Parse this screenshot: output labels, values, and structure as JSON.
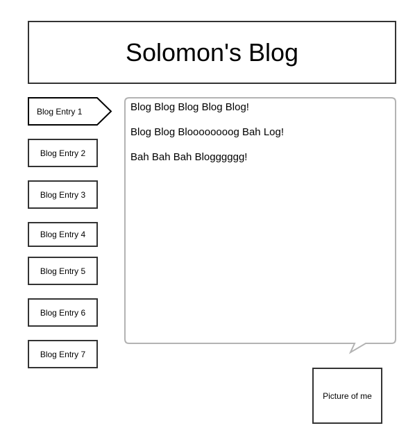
{
  "header": {
    "title": "Solomon's Blog"
  },
  "sidebar": {
    "entries": [
      {
        "label": "Blog Entry 1",
        "selected": true
      },
      {
        "label": "Blog Entry 2"
      },
      {
        "label": "Blog Entry 3"
      },
      {
        "label": "Blog Entry 4"
      },
      {
        "label": "Blog Entry 5"
      },
      {
        "label": "Blog Entry 6"
      },
      {
        "label": "Blog Entry 7"
      }
    ]
  },
  "content": {
    "paragraphs": [
      "Blog Blog Blog Blog Blog!",
      "Blog Blog Bloooooooog Bah Log!",
      "Bah Bah Bah Blogggggg!"
    ]
  },
  "picture": {
    "label": "Picture of me"
  }
}
